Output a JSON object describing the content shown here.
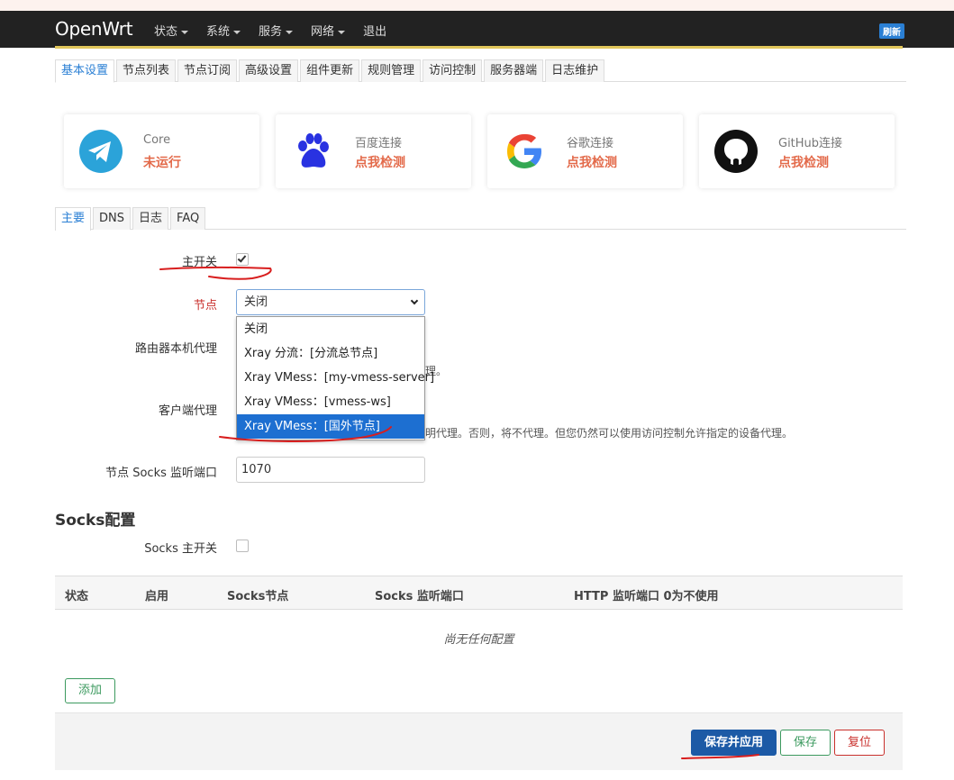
{
  "navbar": {
    "brand": "OpenWrt",
    "menu": [
      "状态",
      "系统",
      "服务",
      "网络"
    ],
    "logout": "退出",
    "refresh": "刷新"
  },
  "tabs_top": [
    "基本设置",
    "节点列表",
    "节点订阅",
    "高级设置",
    "组件更新",
    "规则管理",
    "访问控制",
    "服务器端",
    "日志维护"
  ],
  "status_cards": [
    {
      "title": "Core",
      "status": "未运行",
      "icon": "telegram-icon"
    },
    {
      "title": "百度连接",
      "status": "点我检测",
      "icon": "baidu-paw-icon"
    },
    {
      "title": "谷歌连接",
      "status": "点我检测",
      "icon": "google-icon"
    },
    {
      "title": "GitHub连接",
      "status": "点我检测",
      "icon": "github-icon"
    }
  ],
  "tabs_sub": [
    "主要",
    "DNS",
    "日志",
    "FAQ"
  ],
  "form": {
    "main_switch_label": "主开关",
    "main_switch_checked": true,
    "node_label": "节点",
    "node_value": "关闭",
    "node_options": [
      "关闭",
      "Xray 分流：[分流总节点]",
      "Xray VMess：[my-vmess-server]",
      "Xray VMess：[vmess-ws]",
      "Xray VMess：[国外节点]"
    ],
    "node_selected_index": 4,
    "router_proxy_label": "路由器本机代理",
    "router_proxy_hint": "理。",
    "client_proxy_label": "客户端代理",
    "client_proxy_hint": "明代理。否则，将不代理。但您仍然可以使用访问控制允许指定的设备代理。",
    "socks_port_label": "节点 Socks 监听端口",
    "socks_port_value": "1070"
  },
  "socks": {
    "heading": "Socks配置",
    "switch_label": "Socks 主开关",
    "switch_checked": false,
    "columns": [
      "状态",
      "启用",
      "Socks节点",
      "Socks 监听端口",
      "HTTP 监听端口 0为不使用"
    ],
    "empty_text": "尚无任何配置",
    "add_button": "添加"
  },
  "actions": {
    "save_apply": "保存并应用",
    "save": "保存",
    "reset": "复位"
  },
  "colors": {
    "accent": "#2a7fd4",
    "status_red": "#e36a4a",
    "annotation": "#d81e1e"
  }
}
